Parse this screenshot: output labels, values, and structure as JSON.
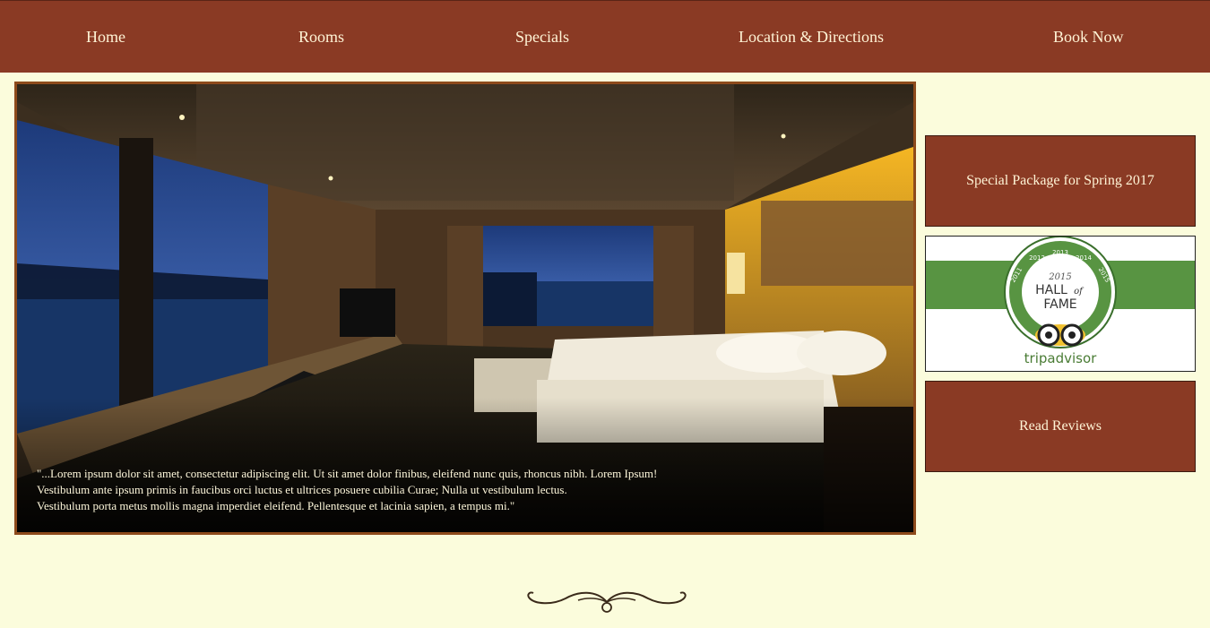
{
  "nav": {
    "items": [
      {
        "label": "Home"
      },
      {
        "label": "Rooms"
      },
      {
        "label": "Specials"
      },
      {
        "label": "Location & Directions"
      },
      {
        "label": "Book Now"
      }
    ]
  },
  "hero": {
    "quote_lines": [
      "\"...Lorem ipsum dolor sit amet, consectetur adipiscing elit. Ut sit amet dolor finibus, eleifend nunc quis, rhoncus nibh. Lorem Ipsum!",
      "Vestibulum ante ipsum primis in faucibus orci luctus et ultrices posuere cubilia Curae; Nulla ut vestibulum lectus.",
      "Vestibulum porta metus mollis magna imperdiet eleifend. Pellentesque et lacinia sapien, a tempus mi.\""
    ]
  },
  "sidebar": {
    "special_label": "Special Package for Spring 2017",
    "reviews_label": "Read Reviews",
    "badge": {
      "year": "2015",
      "hall": "HALL",
      "of": "of",
      "fame": "FAME",
      "years_ring": [
        "2011",
        "2012",
        "2013",
        "2014",
        "2015"
      ],
      "brand": "tripadvisor"
    }
  },
  "colors": {
    "background": "#fbfcdc",
    "brand_brown": "#8a3a24",
    "nav_text": "#fff4d6",
    "badge_green": "#589442"
  },
  "icons": [
    "owl-eyes-icon",
    "flourish-divider-icon"
  ]
}
